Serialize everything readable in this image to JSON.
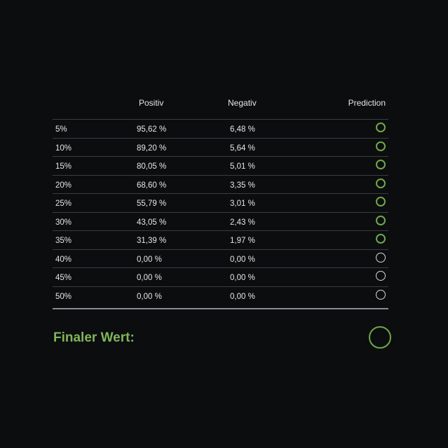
{
  "table": {
    "headers": {
      "positiv": "Positiv",
      "negativ": "Negativ",
      "prediction": "Prediction"
    },
    "rows": [
      {
        "pct": "5%",
        "positiv": "95,62 %",
        "negativ": "6,48 %",
        "prediction": "positive"
      },
      {
        "pct": "10%",
        "positiv": "89,20 %",
        "negativ": "5,64 %",
        "prediction": "positive"
      },
      {
        "pct": "15%",
        "positiv": "80,05 %",
        "negativ": "5,01 %",
        "prediction": "positive"
      },
      {
        "pct": "20%",
        "positiv": "68,60 %",
        "negativ": "3,35 %",
        "prediction": "positive"
      },
      {
        "pct": "25%",
        "positiv": "55,79 %",
        "negativ": "3,01 %",
        "prediction": "positive"
      },
      {
        "pct": "30%",
        "positiv": "43,05 %",
        "negativ": "2,43 %",
        "prediction": "positive"
      },
      {
        "pct": "35%",
        "positiv": "31,39 %",
        "negativ": "1,97 %",
        "prediction": "positive"
      },
      {
        "pct": "40%",
        "positiv": "0,00 %",
        "negativ": "0,00 %",
        "prediction": "neutral"
      },
      {
        "pct": "45%",
        "positiv": "0,00 %",
        "negativ": "0,00 %",
        "prediction": "neutral"
      },
      {
        "pct": "50%",
        "positiv": "0,00 %",
        "negativ": "0,00 %",
        "prediction": "neutral"
      }
    ]
  },
  "final": {
    "label": "Finaler Wert:",
    "prediction": "positive"
  },
  "colors": {
    "positive": "#6fa84a",
    "neutral": "#d8d8d8",
    "accent_text": "#7fb55a",
    "background": "#0c0d0f"
  },
  "icons": {
    "positive": "green-circle-icon",
    "neutral": "white-circle-icon"
  }
}
